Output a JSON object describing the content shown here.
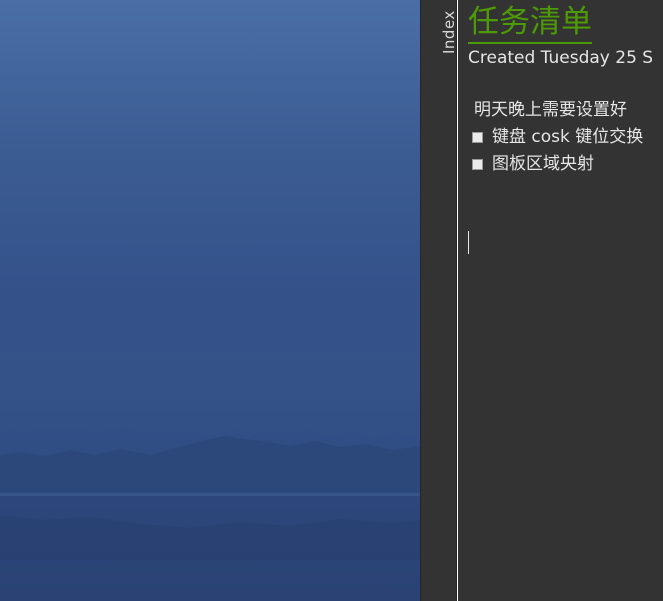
{
  "sidebar": {
    "index_tab_label": "Index"
  },
  "page": {
    "title": "任务清单",
    "created_line": "Created Tuesday 25 S",
    "note_heading": "明天晚上需要设置好",
    "tasks": [
      {
        "label": "键盘 cosk 键位交换",
        "checked": false
      },
      {
        "label": "图板区域央射",
        "checked": false
      }
    ]
  },
  "colors": {
    "title_accent": "#4e9a06",
    "editor_background": "#333333",
    "text": "#e6e6e6"
  }
}
